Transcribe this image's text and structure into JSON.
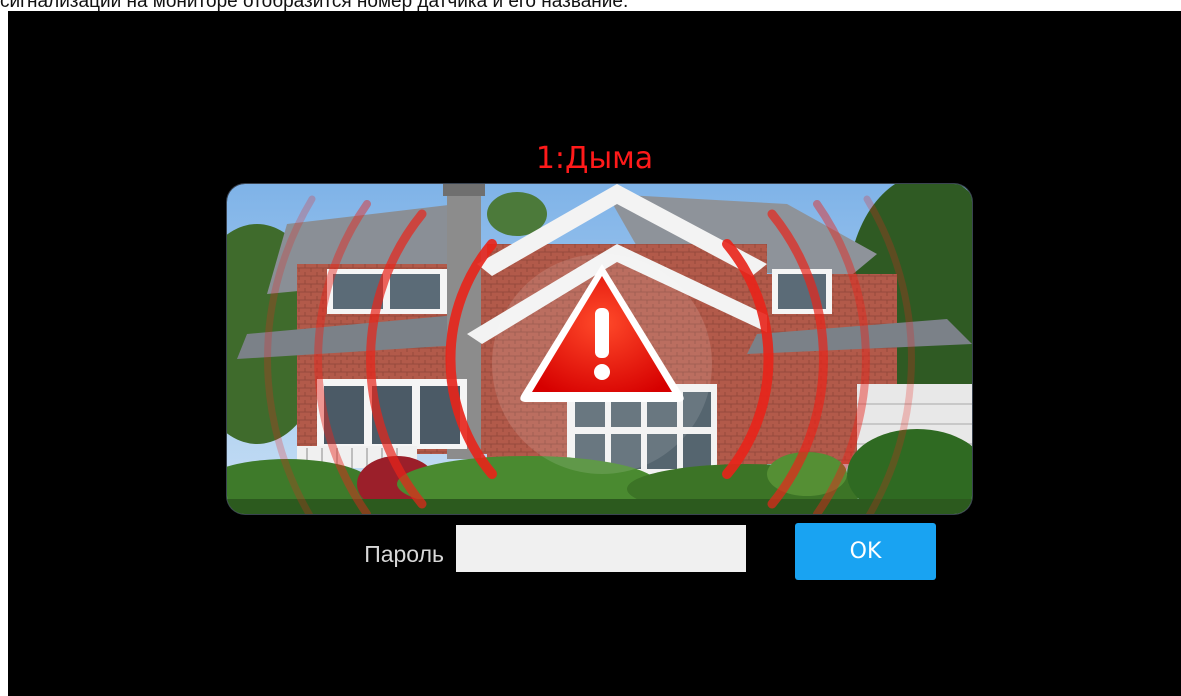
{
  "caption": "сигнализации на мониторе отобразится номер датчика и его название.",
  "alarm": {
    "title": "1:Дыма",
    "icon": "warning-triangle-icon"
  },
  "password": {
    "label": "Пароль",
    "value": "",
    "placeholder": ""
  },
  "ok_button": {
    "label": "OK"
  },
  "colors": {
    "alarm_text": "#ff1a1a",
    "ok_button": "#19a3f2",
    "background": "#000000"
  }
}
